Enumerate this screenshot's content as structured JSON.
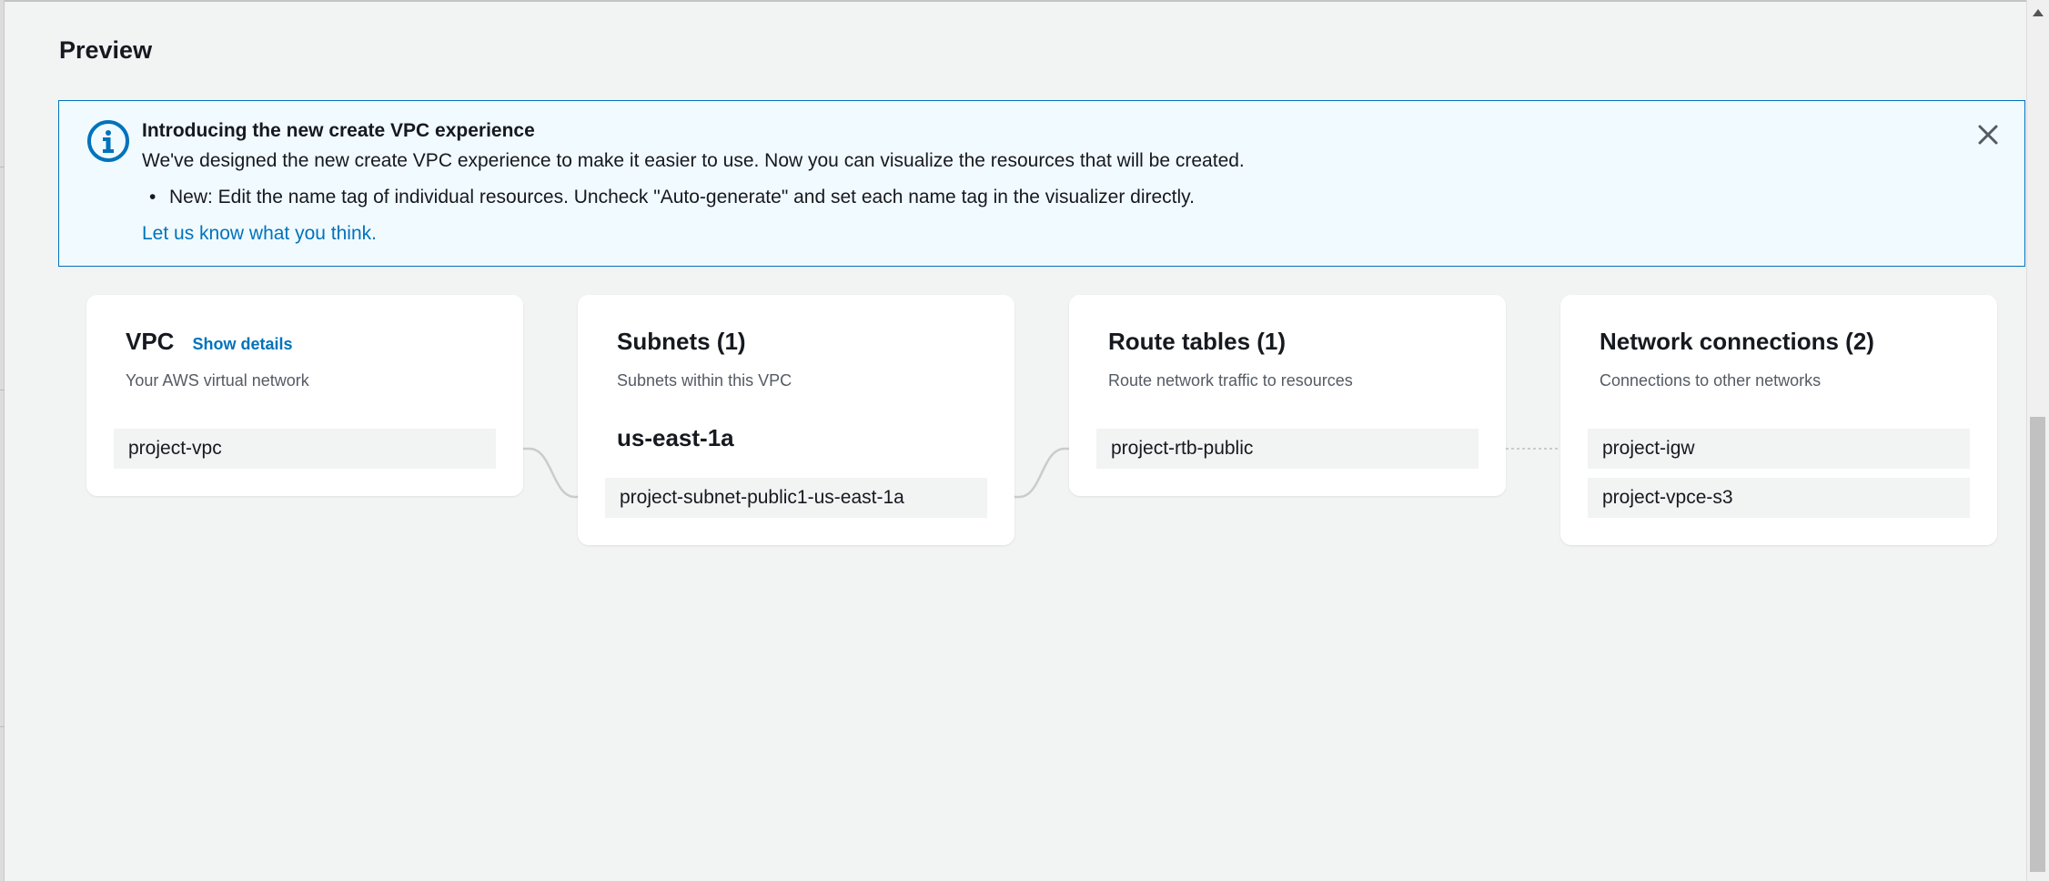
{
  "page": {
    "title": "Preview"
  },
  "banner": {
    "title": "Introducing the new create VPC experience",
    "body": "We've designed the new create VPC experience to make it easier to use. Now you can visualize the resources that will be created.",
    "bullet": "New: Edit the name tag of individual resources. Uncheck \"Auto-generate\" and set each name tag in the visualizer directly.",
    "link": "Let us know what you think.",
    "icon": "info-icon",
    "close_icon": "close-icon"
  },
  "cards": {
    "vpc": {
      "title": "VPC",
      "link": "Show details",
      "subtitle": "Your AWS virtual network",
      "resources": [
        "project-vpc"
      ]
    },
    "subnets": {
      "title": "Subnets (1)",
      "subtitle": "Subnets within this VPC",
      "az": "us-east-1a",
      "resources": [
        "project-subnet-public1-us-east-1a"
      ]
    },
    "route_tables": {
      "title": "Route tables (1)",
      "subtitle": "Route network traffic to resources",
      "resources": [
        "project-rtb-public"
      ]
    },
    "network_connections": {
      "title": "Network connections (2)",
      "subtitle": "Connections to other networks",
      "resources": [
        "project-igw",
        "project-vpce-s3"
      ]
    }
  },
  "colors": {
    "accent": "#0073bb",
    "banner_bg": "#f1faff",
    "page_bg": "#f2f3f3",
    "connector": "#c9cccc"
  }
}
